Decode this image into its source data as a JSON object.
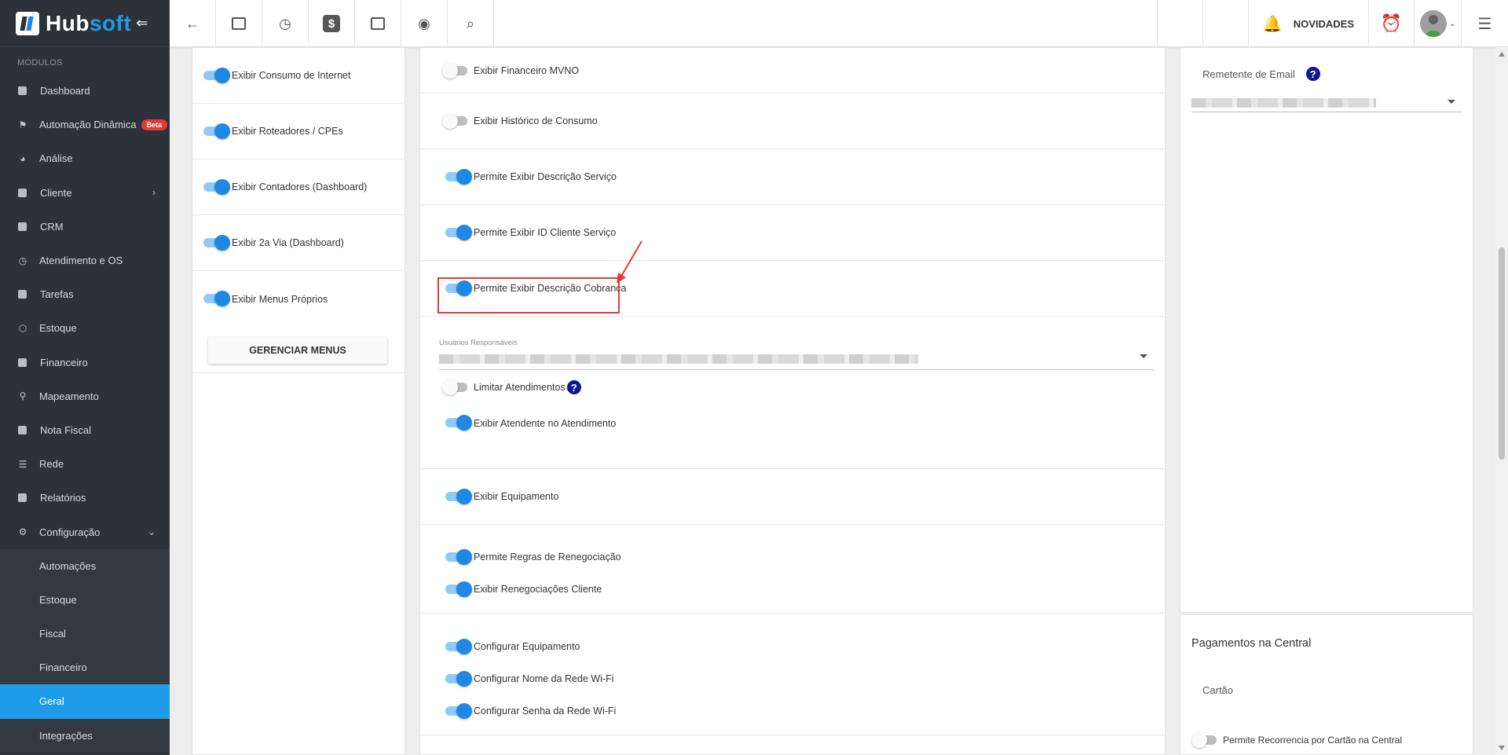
{
  "brand": {
    "part1": "Hub",
    "part2": "soft",
    "collapse": "⇐"
  },
  "sidebar": {
    "section_label": "MÓDULOS",
    "items": [
      {
        "label": "Dashboard",
        "icon": "dashboard-icon"
      },
      {
        "label": "Automação Dinâmica",
        "icon": "automation-icon",
        "badge": "Beta"
      },
      {
        "label": "Análise",
        "icon": "pie-chart-icon"
      },
      {
        "label": "Cliente",
        "icon": "client-icon",
        "chevron": "›"
      },
      {
        "label": "CRM",
        "icon": "crm-icon"
      },
      {
        "label": "Atendimento e OS",
        "icon": "calendar-clock-icon"
      },
      {
        "label": "Tarefas",
        "icon": "tasks-icon"
      },
      {
        "label": "Estoque",
        "icon": "box-icon"
      },
      {
        "label": "Financeiro",
        "icon": "money-icon"
      },
      {
        "label": "Mapeamento",
        "icon": "map-pin-icon"
      },
      {
        "label": "Nota Fiscal",
        "icon": "invoice-icon"
      },
      {
        "label": "Rede",
        "icon": "network-icon"
      },
      {
        "label": "Relatórios",
        "icon": "report-icon"
      },
      {
        "label": "Configuração",
        "icon": "gear-icon",
        "chevron": "⌄"
      }
    ],
    "sub_items": [
      "Automações",
      "Estoque",
      "Fiscal",
      "Financeiro",
      "Geral",
      "Integrações"
    ],
    "active_sub": "Geral"
  },
  "topbar": {
    "buttons": [
      "back-icon",
      "contact-card-icon",
      "calendar-clock-icon",
      "dollar-icon",
      "terminal-icon",
      "eye-icon",
      "search-icon"
    ],
    "novidades": "NOVIDADES",
    "colors": {
      "accent": "#1e9be9",
      "bell": "#1565c0",
      "alarm": "#e53935"
    }
  },
  "left_panel": {
    "toggles": [
      {
        "label": "Exibir Consumo de Internet",
        "on": true
      },
      {
        "label": "Exibir Roteadores / CPEs",
        "on": true
      },
      {
        "label": "Exibir Contadores (Dashboard)",
        "on": true
      },
      {
        "label": "Exibir 2a Via (Dashboard)",
        "on": true
      },
      {
        "label": "Exibir Menus Próprios",
        "on": true
      }
    ],
    "manage_button": "GERENCIAR MENUS"
  },
  "mid_panel": {
    "toggles": [
      {
        "label": "Exibir Financeiro MVNO",
        "on": false
      },
      {
        "label": "Exibir Histórico de Consumo",
        "on": false
      },
      {
        "label": "Permite Exibir Descrição Serviço",
        "on": true
      },
      {
        "label": "Permite Exibir ID Cliente Serviço",
        "on": true
      },
      {
        "label": "Permite Exibir Descrição Cobrança",
        "on": true
      }
    ],
    "users_label": "Usuários Responsáveis",
    "limit": {
      "label": "Limitar Atendimentos",
      "on": false,
      "help": "?"
    },
    "show_attendant": {
      "label": "Exibir Atendente no Atendimento",
      "on": true
    },
    "equipment": {
      "label": "Exibir Equipamento",
      "on": true
    },
    "renegotiation": [
      {
        "label": "Permite Regras de Renegociação",
        "on": true
      },
      {
        "label": "Exibir Renegociações Cliente",
        "on": true
      }
    ],
    "configure": [
      {
        "label": "Configurar Equipamento",
        "on": true
      },
      {
        "label": "Configurar Nome da Rede Wi-Fi",
        "on": true
      },
      {
        "label": "Configurar Senha da Rede Wi-Fi",
        "on": true
      }
    ]
  },
  "right_panel": {
    "email_sender_label": "Remetente de Email",
    "help": "?",
    "payments_title": "Pagamentos na Central",
    "card_label": "Cartão",
    "card_toggle": {
      "label": "Permite Recorrencia por Cartão na Central",
      "on": false
    }
  }
}
